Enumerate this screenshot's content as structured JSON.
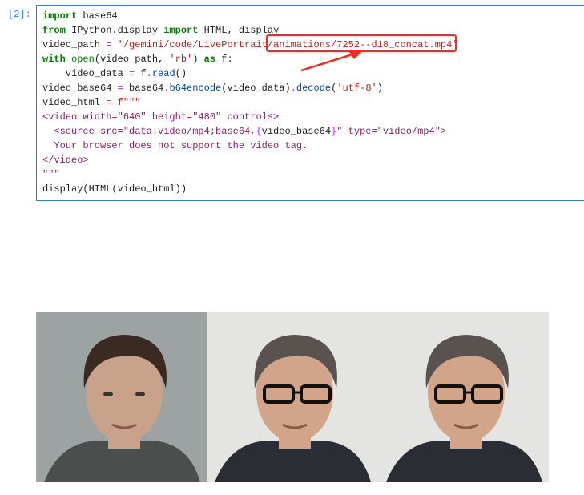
{
  "cell": {
    "prompt": "[2]:",
    "lines": [
      [
        [
          "import",
          "kw"
        ],
        [
          " base64",
          ""
        ]
      ],
      [
        [
          "from",
          "kw"
        ],
        [
          " IPython.display ",
          ""
        ],
        [
          "import",
          "kw"
        ],
        [
          " HTML, display",
          ""
        ]
      ],
      [
        [
          "video_path ",
          ""
        ],
        [
          "=",
          "op"
        ],
        [
          " ",
          ""
        ],
        [
          "'/gemini/code/LivePortrait/animations/7252--d18_concat.mp4'",
          "str"
        ]
      ],
      [
        [
          "with",
          "kw"
        ],
        [
          " ",
          ""
        ],
        [
          "open",
          "bi"
        ],
        [
          "(video_path, ",
          ""
        ],
        [
          "'rb'",
          "str"
        ],
        [
          ") ",
          ""
        ],
        [
          "as",
          "kw"
        ],
        [
          " f:",
          ""
        ]
      ],
      [
        [
          "    video_data ",
          ""
        ],
        [
          "=",
          "op"
        ],
        [
          " f",
          ""
        ],
        [
          ".",
          "op"
        ],
        [
          "read",
          "fn"
        ],
        [
          "()",
          ""
        ]
      ],
      [
        [
          "video_base64 ",
          ""
        ],
        [
          "=",
          "op"
        ],
        [
          " base64",
          ""
        ],
        [
          ".",
          "op"
        ],
        [
          "b64encode",
          "fn"
        ],
        [
          "(video_data)",
          ""
        ],
        [
          ".",
          "op"
        ],
        [
          "decode",
          "fn"
        ],
        [
          "(",
          ""
        ],
        [
          "'utf-8'",
          "str"
        ],
        [
          ")",
          ""
        ]
      ],
      [
        [
          "video_html ",
          ""
        ],
        [
          "=",
          "op"
        ],
        [
          " f\"\"\"",
          "str"
        ]
      ],
      [
        [
          "<video width=\"640\" height=\"480\" controls>",
          "fs"
        ]
      ],
      [
        [
          "  <source src=\"data:video/mp4;base64,",
          "fs"
        ],
        [
          "{",
          "op"
        ],
        [
          "video_base64",
          ""
        ],
        [
          "}",
          "op"
        ],
        [
          "\" type=\"video/mp4\">",
          "fs"
        ]
      ],
      [
        [
          "  Your browser does not support the video tag.",
          "fs"
        ]
      ],
      [
        [
          "</video>",
          "fs"
        ]
      ],
      [
        [
          "\"\"\"",
          "fs"
        ]
      ],
      [
        [
          "display(HTML(video_html))",
          ""
        ]
      ]
    ]
  },
  "annotation": {
    "highlight_color": "#f02b23"
  },
  "output": {
    "frames": [
      {
        "kind": "source-face",
        "bg": "#9da3a3",
        "skin": "#c9a28c",
        "hair": "#3a2a22",
        "shirt": "#4a4e4c"
      },
      {
        "kind": "animated-face",
        "bg": "#e4e4e2",
        "skin": "#d2a48a",
        "hair": "#5a524e",
        "shirt": "#2a2d33"
      },
      {
        "kind": "animated-face",
        "bg": "#e4e4e2",
        "skin": "#d2a48a",
        "hair": "#5a524e",
        "shirt": "#2a2d33"
      }
    ]
  }
}
